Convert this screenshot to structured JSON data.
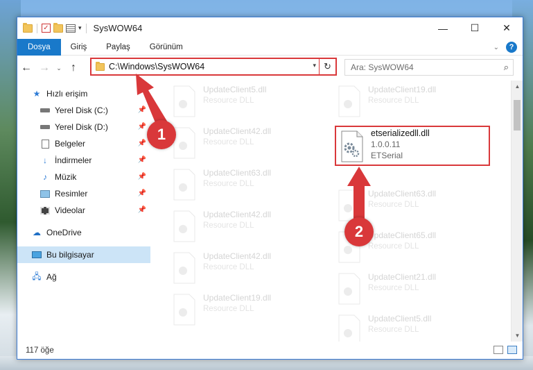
{
  "window": {
    "title": "SysWOW64",
    "controls": [
      "—",
      "☐",
      "✕"
    ]
  },
  "ribbon": {
    "tabs": [
      "Dosya",
      "Giriş",
      "Paylaş",
      "Görünüm"
    ],
    "help": "?"
  },
  "nav": {
    "back": "←",
    "forward": "→",
    "recent": "⌄",
    "up": "↑",
    "address": "C:\\Windows\\SysWOW64",
    "refresh": "↻",
    "search_placeholder": "Ara: SysWOW64"
  },
  "sidebar": {
    "items": [
      {
        "label": "Hızlı erişim",
        "icon": "star-icon"
      },
      {
        "label": "Yerel Disk (C:)",
        "icon": "drive-icon"
      },
      {
        "label": "Yerel Disk (D:)",
        "icon": "drive-icon"
      },
      {
        "label": "Belgeler",
        "icon": "documents-icon"
      },
      {
        "label": "İndirmeler",
        "icon": "download-icon"
      },
      {
        "label": "Müzik",
        "icon": "music-icon"
      },
      {
        "label": "Resimler",
        "icon": "pictures-icon"
      },
      {
        "label": "Videolar",
        "icon": "video-icon"
      },
      {
        "label": "OneDrive",
        "icon": "cloud-icon"
      },
      {
        "label": "Bu bilgisayar",
        "icon": "computer-icon"
      },
      {
        "label": "Ağ",
        "icon": "network-icon"
      }
    ]
  },
  "files": [
    {
      "name": "UpdateClient5.dll",
      "desc": "Resource DLL"
    },
    {
      "name": "UpdateClient19.dll",
      "desc": "Resource DLL"
    },
    {
      "name": "UpdateClient42.dll",
      "desc": "Resource DLL"
    },
    {
      "name": "UpdateClient63.dll",
      "desc": "Resource DLL"
    },
    {
      "name": "UpdateClient63.dll",
      "desc": "Resource DLL"
    },
    {
      "name": "UpdateClient42.dll",
      "desc": "Resource DLL"
    },
    {
      "name": "UpdateClient65.dll",
      "desc": "Resource DLL"
    },
    {
      "name": "UpdateClient42.dll",
      "desc": "Resource DLL"
    },
    {
      "name": "UpdateClient21.dll",
      "desc": "Resource DLL"
    },
    {
      "name": "UpdateClient19.dll",
      "desc": "Resource DLL"
    },
    {
      "name": "UpdateClient5.dll",
      "desc": "Resource DLL"
    }
  ],
  "highlighted_file": {
    "name": "etserializedll.dll",
    "version": "1.0.0.11",
    "company": "ETSerial"
  },
  "status": {
    "count": "117 öğe"
  },
  "annotations": {
    "badge1": "1",
    "badge2": "2",
    "color": "#d9383a"
  }
}
